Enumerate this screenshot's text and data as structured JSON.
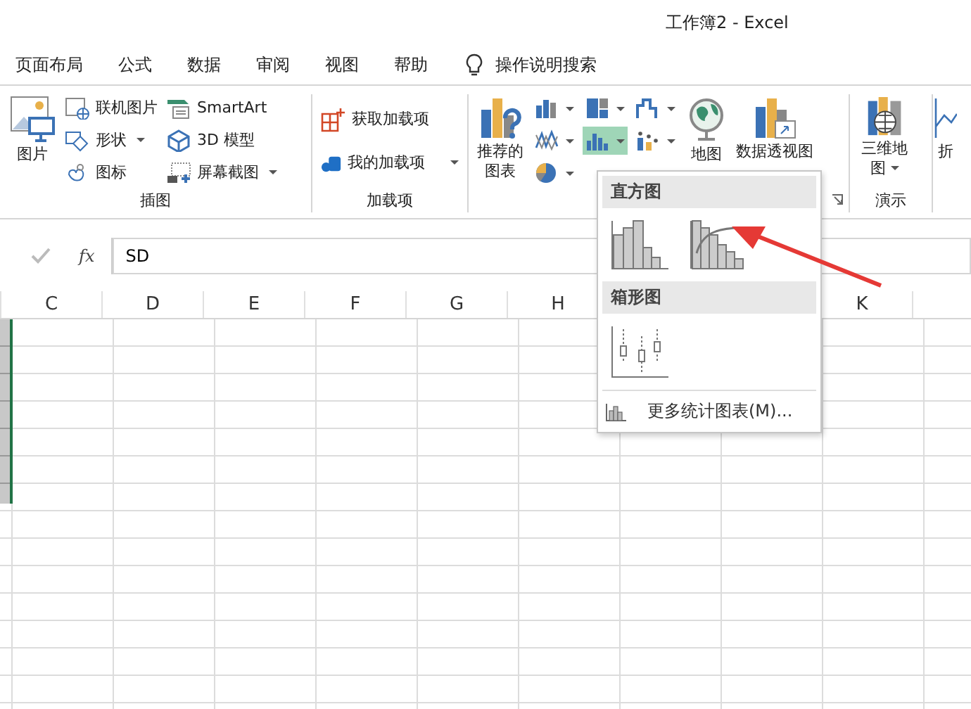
{
  "window": {
    "title": "工作簿2  -  Excel"
  },
  "menu_tabs": [
    {
      "label": "页面布局"
    },
    {
      "label": "公式"
    },
    {
      "label": "数据"
    },
    {
      "label": "审阅"
    },
    {
      "label": "视图"
    },
    {
      "label": "帮助"
    }
  ],
  "tell_me": {
    "placeholder": "操作说明搜索"
  },
  "ribbon": {
    "illustrations": {
      "label": "插图",
      "large": {
        "label": "图片"
      },
      "columns": [
        [
          {
            "label": "联机图片",
            "dropdown": false
          },
          {
            "label": "形状",
            "dropdown": true
          },
          {
            "label": "图标",
            "dropdown": false
          }
        ],
        [
          {
            "label": "SmartArt",
            "dropdown": false
          },
          {
            "label": "3D 模型",
            "dropdown": false
          },
          {
            "label": "屏幕截图",
            "dropdown": true
          }
        ]
      ]
    },
    "addins": {
      "label": "加载项",
      "items": [
        {
          "label": "获取加载项",
          "dropdown": false
        },
        {
          "label": "我的加载项",
          "dropdown": true
        }
      ]
    },
    "charts": {
      "recommended": {
        "label": "推荐的图表"
      },
      "button_columns": [
        [
          {
            "dropdown": true,
            "selected": false
          },
          {
            "dropdown": true,
            "selected": false
          },
          {
            "dropdown": true,
            "selected": false
          }
        ],
        [
          {
            "dropdown": true,
            "selected": false
          },
          {
            "dropdown": true,
            "selected": true
          }
        ],
        [
          {
            "dropdown": true,
            "selected": false
          },
          {
            "dropdown": true,
            "selected": false
          }
        ]
      ],
      "maps": {
        "label": "地图"
      },
      "pivot_chart": {
        "label": "数据透视图"
      }
    },
    "tours": {
      "label": "演示",
      "button": {
        "label": "三维地图",
        "dropdown": true
      }
    },
    "cut_button": {
      "label": "折"
    }
  },
  "formula_bar": {
    "function_button": "fx",
    "value": "SD"
  },
  "columns": [
    {
      "label": "C"
    },
    {
      "label": "D"
    },
    {
      "label": "E"
    },
    {
      "label": "F"
    },
    {
      "label": "G"
    },
    {
      "label": "H"
    },
    {
      "label": "K"
    }
  ],
  "chart_menu": {
    "sections": [
      {
        "title": "直方图"
      },
      {
        "title": "箱形图"
      }
    ],
    "more_link": "更多统计图表(M)..."
  }
}
